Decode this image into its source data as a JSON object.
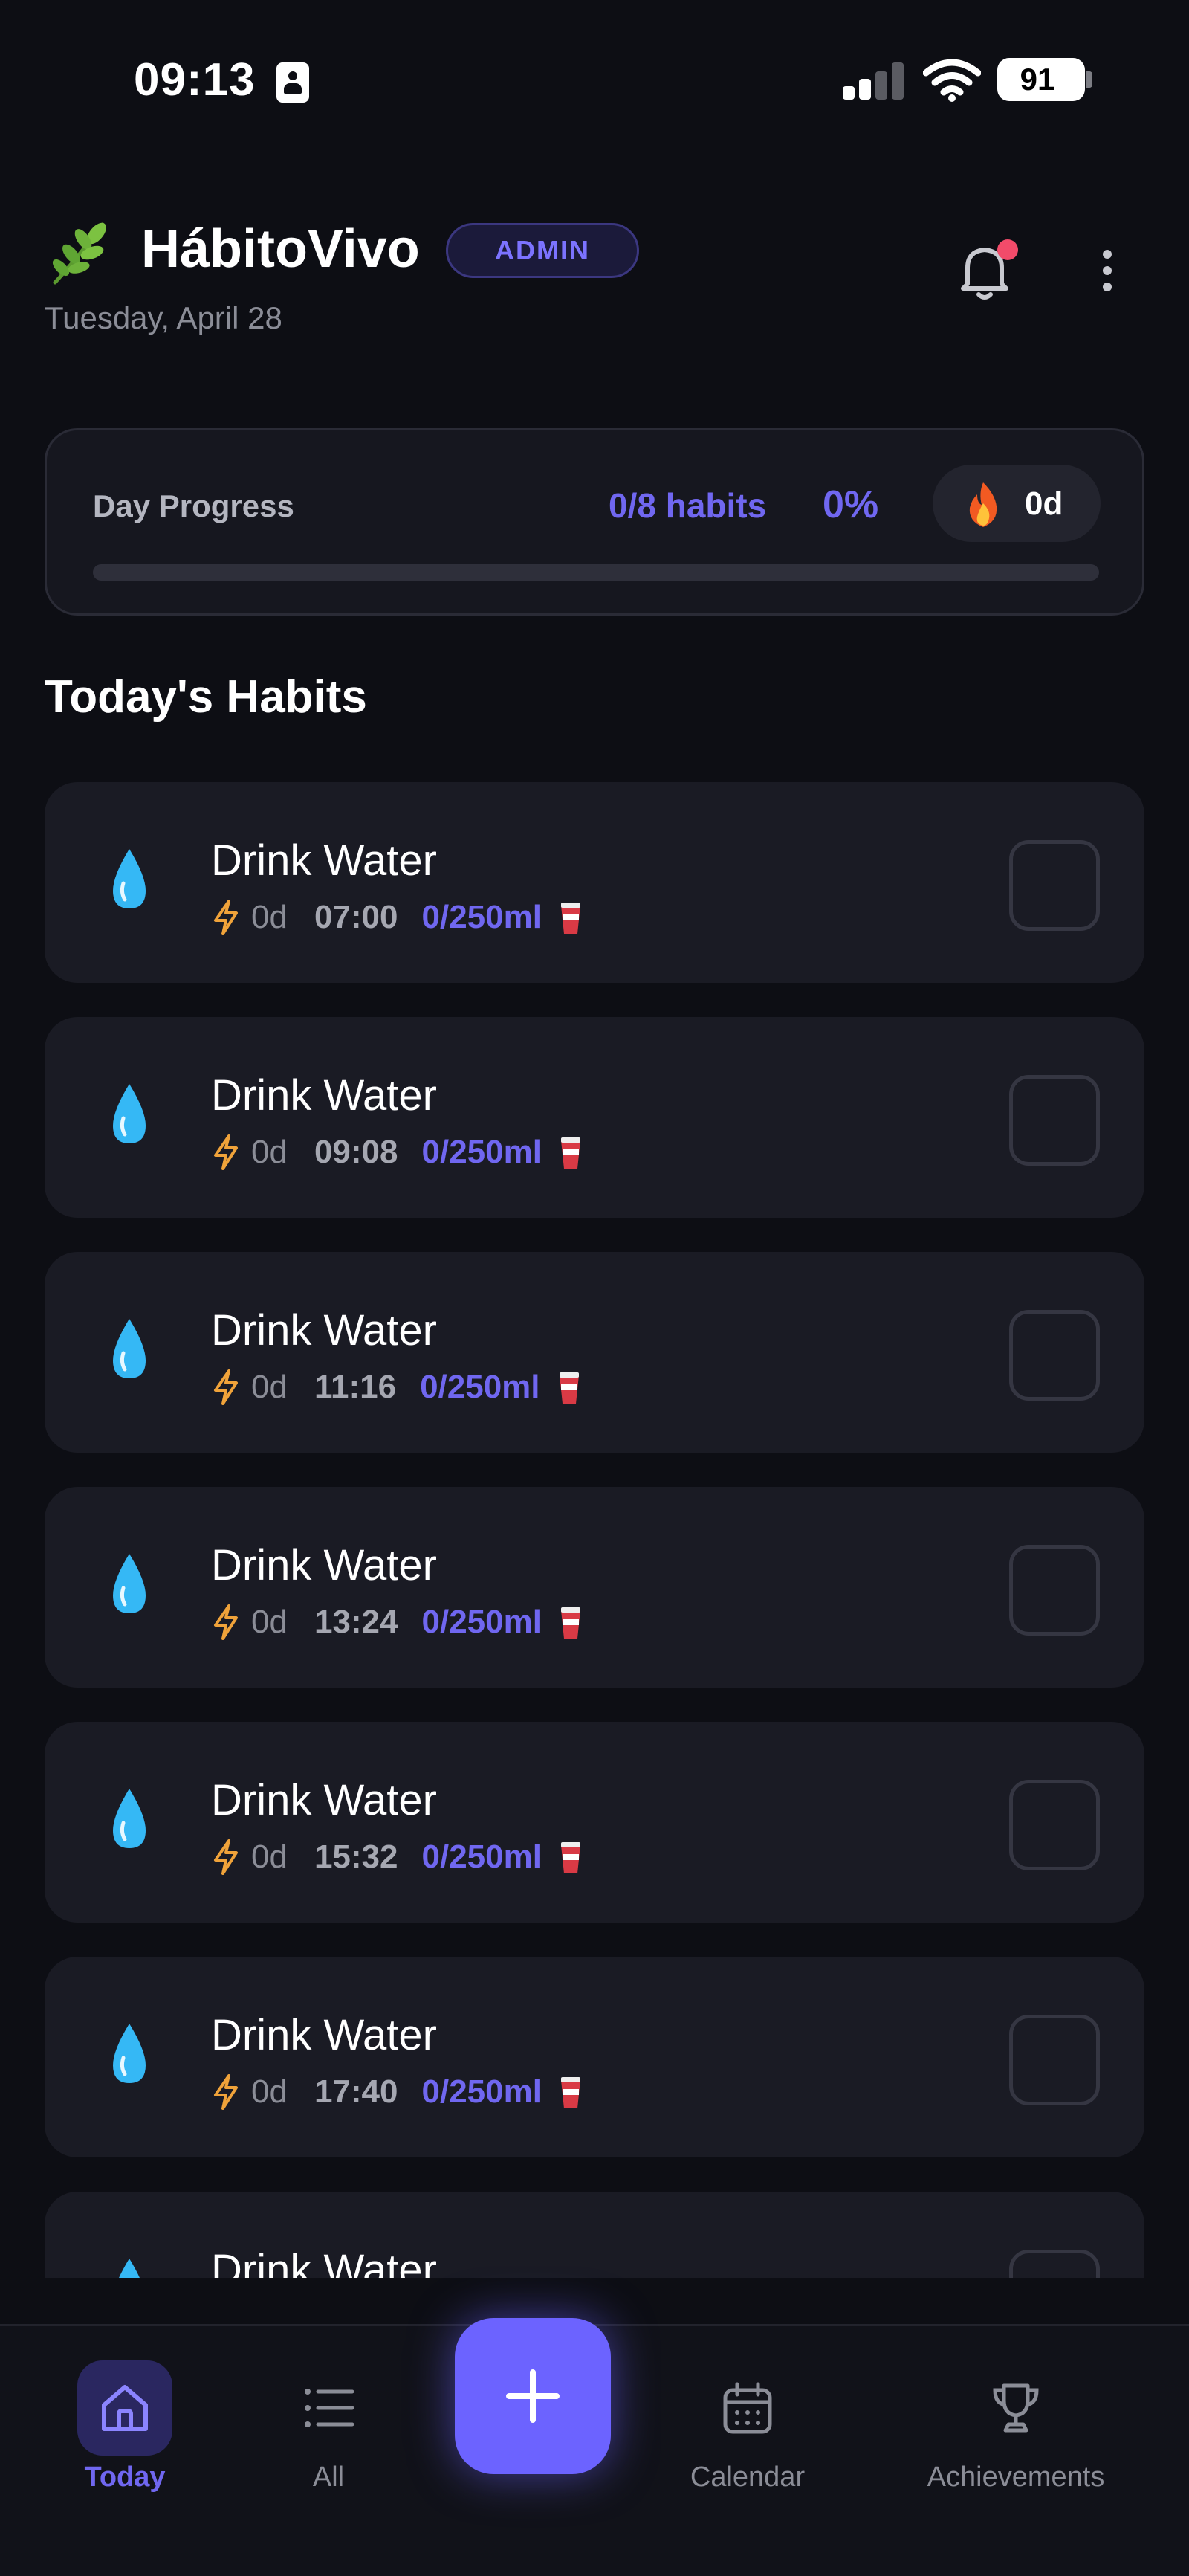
{
  "status_bar": {
    "time": "09:13",
    "battery": "91",
    "sim_icon": "contact-card-icon",
    "signal_icon": "cellular-signal-icon",
    "wifi_icon": "wifi-icon"
  },
  "header": {
    "app_name": "HábitoVivo",
    "logo_icon": "herb-leaf-icon",
    "role_badge": "ADMIN",
    "date": "Tuesday, April 28",
    "notification_icon": "bell-icon",
    "menu_icon": "more-vertical-icon"
  },
  "progress": {
    "label": "Day Progress",
    "habits_done": "0/8 habits",
    "percent": "0%",
    "percent_value": 0,
    "streak": "0d",
    "streak_icon": "fire-icon"
  },
  "section_title": "Today's Habits",
  "habits": [
    {
      "name": "Drink Water",
      "streak": "0d",
      "time": "07:00",
      "amount": "0/250ml",
      "icon": "water-drop-icon",
      "checked": false
    },
    {
      "name": "Drink Water",
      "streak": "0d",
      "time": "09:08",
      "amount": "0/250ml",
      "icon": "water-drop-icon",
      "checked": false
    },
    {
      "name": "Drink Water",
      "streak": "0d",
      "time": "11:16",
      "amount": "0/250ml",
      "icon": "water-drop-icon",
      "checked": false
    },
    {
      "name": "Drink Water",
      "streak": "0d",
      "time": "13:24",
      "amount": "0/250ml",
      "icon": "water-drop-icon",
      "checked": false
    },
    {
      "name": "Drink Water",
      "streak": "0d",
      "time": "15:32",
      "amount": "0/250ml",
      "icon": "water-drop-icon",
      "checked": false
    },
    {
      "name": "Drink Water",
      "streak": "0d",
      "time": "17:40",
      "amount": "0/250ml",
      "icon": "water-drop-icon",
      "checked": false
    },
    {
      "name": "Drink Water",
      "icon": "water-drop-icon",
      "checked": false
    }
  ],
  "nav": {
    "today": "Today",
    "all": "All",
    "calendar": "Calendar",
    "achievements": "Achievements",
    "add_icon": "plus-icon",
    "active": "today"
  },
  "colors": {
    "background": "#0d0e14",
    "card": "#1a1b24",
    "accent": "#7067f0",
    "fab": "#6c63ff",
    "badge_text": "#7c73ff",
    "notification_dot": "#f24b6a",
    "streak_bolt": "#f0a33a"
  }
}
